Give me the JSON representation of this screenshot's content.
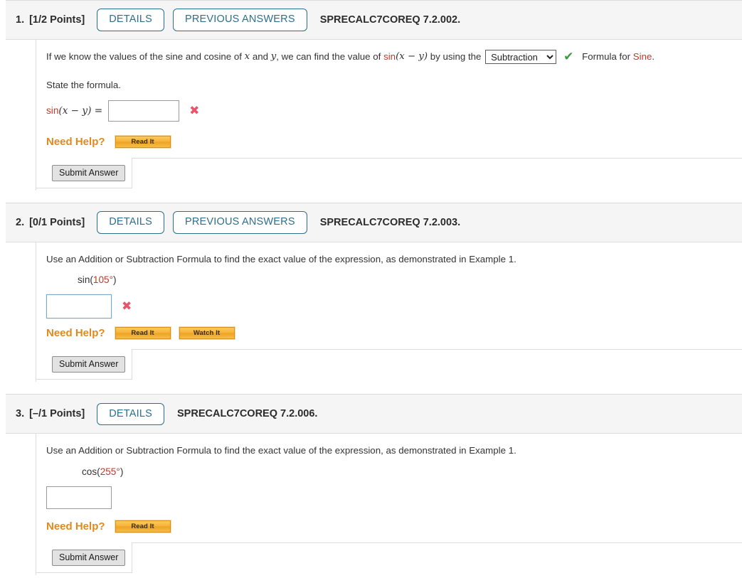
{
  "questions": [
    {
      "number": "1.",
      "points": "[1/2 Points]",
      "details_label": "DETAILS",
      "previous_answers_label": "PREVIOUS ANSWERS",
      "has_previous_answers": true,
      "code": "SPRECALC7COREQ 7.2.002.",
      "prompt": {
        "part1": "If we know the values of the sine and cosine of ",
        "var1": "x",
        "part2": " and ",
        "var2": "y",
        "part3": ", we can find the value of ",
        "expr_fn": "sin",
        "expr_arg": "(x − y)",
        "part4": " by using the ",
        "part5": " Formula for ",
        "highlight": "Sine",
        "part6": "."
      },
      "dropdown": {
        "selected": "Subtraction",
        "options": [
          "Addition",
          "Subtraction"
        ]
      },
      "status_icon": "check-icon",
      "sub_label": "State the formula.",
      "formula_lead_fn": "sin",
      "formula_lead_arg": "(x − y) =",
      "answer_value": "",
      "answer_status": "x-icon",
      "need_help_label": "Need Help?",
      "help_buttons": [
        "Read It"
      ],
      "submit_label": "Submit Answer"
    },
    {
      "number": "2.",
      "points": "[0/1 Points]",
      "details_label": "DETAILS",
      "previous_answers_label": "PREVIOUS ANSWERS",
      "has_previous_answers": true,
      "code": "SPRECALC7COREQ 7.2.003.",
      "instruction": "Use an Addition or Subtraction Formula to find the exact value of the expression, as demonstrated in Example 1.",
      "expression_fn": "sin",
      "expression_open": "(",
      "expression_value": "105°",
      "expression_close": ")",
      "answer_value": "",
      "answer_focused": true,
      "answer_status": "x-icon",
      "need_help_label": "Need Help?",
      "help_buttons": [
        "Read It",
        "Watch It"
      ],
      "submit_label": "Submit Answer"
    },
    {
      "number": "3.",
      "points": "[–/1 Points]",
      "details_label": "DETAILS",
      "previous_answers_label": "",
      "has_previous_answers": false,
      "code": "SPRECALC7COREQ 7.2.006.",
      "instruction": "Use an Addition or Subtraction Formula to find the exact value of the expression, as demonstrated in Example 1.",
      "expression_fn": "cos",
      "expression_open": "(",
      "expression_value": "255°",
      "expression_close": ")",
      "answer_value": "",
      "answer_focused": false,
      "answer_status": "",
      "need_help_label": "Need Help?",
      "help_buttons": [
        "Read It"
      ],
      "submit_label": "Submit Answer"
    }
  ],
  "colors": {
    "accent_blue": "#2d6e8e",
    "header_bg": "#f5f5f5",
    "border": "#dcdcdc",
    "red_math": "#c0392b",
    "orange": "#e08a1e",
    "green_check": "#3d9b40",
    "red_x": "#e8556b"
  }
}
